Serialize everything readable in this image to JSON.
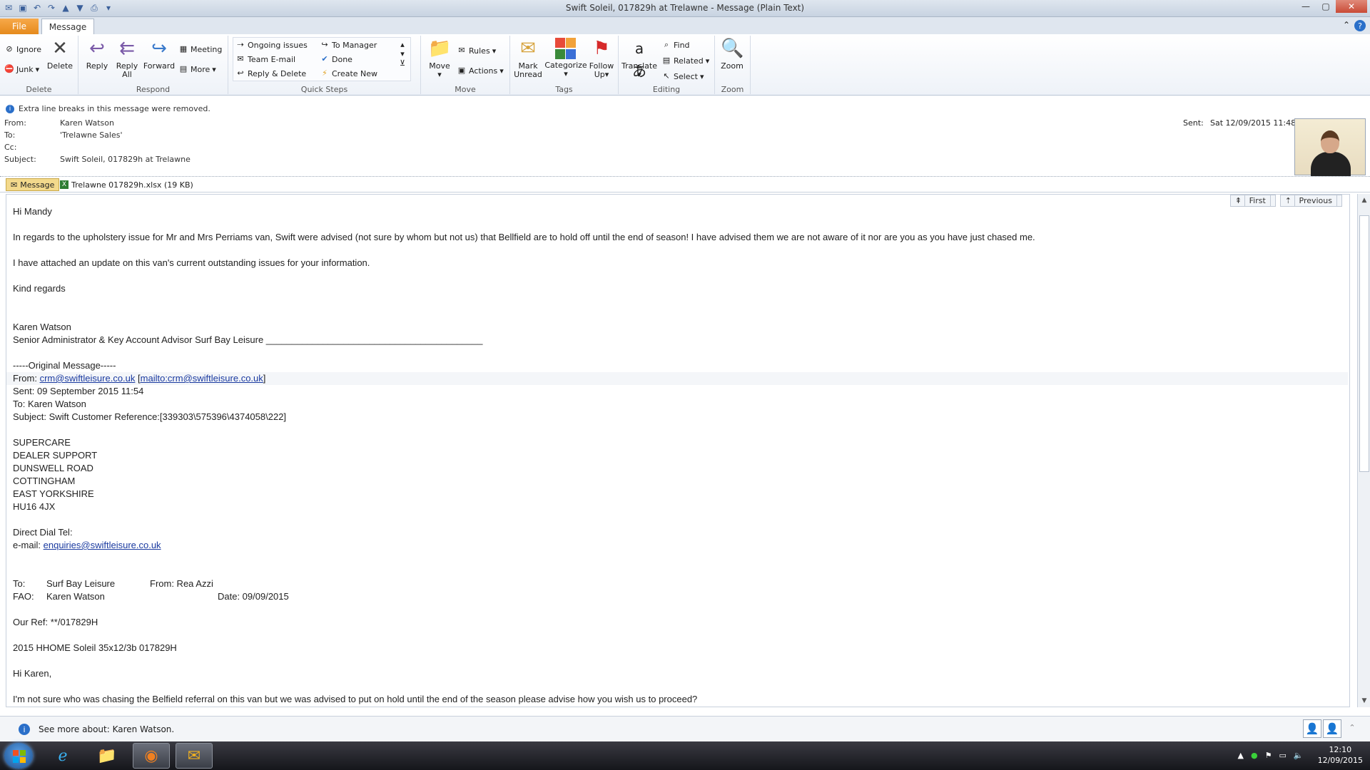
{
  "window": {
    "title": "Swift Soleil, 017829h at Trelawne - Message (Plain Text)"
  },
  "tabs": {
    "file": "File",
    "message": "Message"
  },
  "ribbon": {
    "delete": {
      "ignore": "Ignore",
      "junk": "Junk",
      "delete": "Delete",
      "label": "Delete"
    },
    "respond": {
      "reply": "Reply",
      "reply_all_1": "Reply",
      "reply_all_2": "All",
      "forward": "Forward",
      "meeting": "Meeting",
      "more": "More",
      "label": "Respond"
    },
    "quick_steps": {
      "ongoing": "Ongoing issues",
      "team": "Team E-mail",
      "reply_delete": "Reply & Delete",
      "to_manager": "To Manager",
      "done": "Done",
      "create_new": "Create New",
      "label": "Quick Steps"
    },
    "move": {
      "move": "Move",
      "rules": "Rules",
      "actions": "Actions",
      "label": "Move"
    },
    "tags": {
      "mark_1": "Mark",
      "mark_2": "Unread",
      "categorize": "Categorize",
      "follow_1": "Follow",
      "follow_2": "Up",
      "label": "Tags"
    },
    "editing": {
      "translate": "Translate",
      "find": "Find",
      "related": "Related",
      "select": "Select",
      "label": "Editing"
    },
    "zoom": {
      "zoom": "Zoom",
      "label": "Zoom"
    }
  },
  "header": {
    "info": "Extra line breaks in this message were removed.",
    "from_label": "From:",
    "from": "Karen Watson",
    "to_label": "To:",
    "to": "'Trelawne Sales'",
    "cc_label": "Cc:",
    "subject_label": "Subject:",
    "subject": "Swift Soleil, 017829h at Trelawne",
    "sent_label": "Sent:",
    "sent": "Sat 12/09/2015 11:48"
  },
  "attachments": {
    "message": "Message",
    "file": "Trelawne 017829h.xlsx (19 KB)"
  },
  "nav": {
    "first": "First",
    "previous": "Previous"
  },
  "body": {
    "l1": "Hi Mandy",
    "l2": "In regards to the upholstery issue for Mr and Mrs Perriams van, Swift were advised (not sure by whom but not us) that Bellfield are to hold off until the end of season! I have advised them we are not aware of it nor are you as you have just chased me.",
    "l3": "I have attached an update on this van's current outstanding issues for your information.",
    "l4": "Kind regards",
    "l5": "Karen Watson",
    "l6": "Senior Administrator & Key Account Advisor Surf Bay Leisure __________________________________________",
    "l7": "-----Original Message-----",
    "from_pre": "From: ",
    "from_link": "crm@swiftleisure.co.uk",
    "from_mid": " [",
    "from_link2": "mailto:crm@swiftleisure.co.uk",
    "from_post": "]",
    "l9": "Sent: 09 September 2015 11:54",
    "l10": "To: Karen Watson",
    "l11": "Subject: Swift Customer Reference:[339303\\575396\\4374058\\222]",
    "a1": "SUPERCARE",
    "a2": "DEALER SUPPORT",
    "a3": "DUNSWELL ROAD",
    "a4": "COTTINGHAM",
    "a5": "EAST YORKSHIRE",
    "a6": "HU16 4JX",
    "dial": "Direct Dial Tel:",
    "email_pre": "e-mail:  ",
    "email_link": "enquiries@swiftleisure.co.uk",
    "to_label": "To:",
    "to_val": "Surf Bay Leisure",
    "from_label": "From: Rea Azzi",
    "fao_label": "FAO:",
    "fao_val": "Karen Watson",
    "date_label": "Date:  09/09/2015",
    "ref": "Our Ref: **/017829H",
    "model": "2015 HHOME Soleil 35x12/3b 017829H",
    "hi": "Hi Karen,",
    "last": "I'm not sure who was chasing the Belfield referral on this van but we was advised to put on hold until the end of the season please advise how you wish us to proceed?"
  },
  "people": {
    "text": "See more about: Karen Watson."
  },
  "taskbar": {
    "time": "12:10",
    "date": "12/09/2015"
  }
}
